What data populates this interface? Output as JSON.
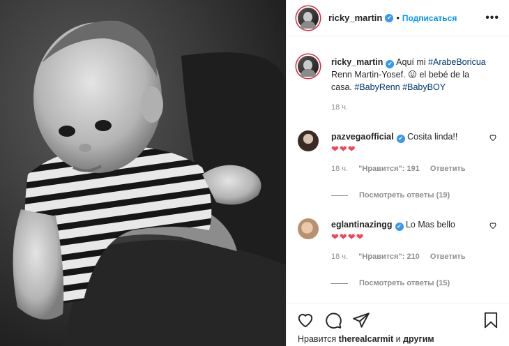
{
  "photo": {
    "alt": ""
  },
  "header": {
    "username": "ricky_martin",
    "separator": "•",
    "follow_label": "Подписаться",
    "more_label": "•••"
  },
  "caption": {
    "username": "ricky_martin",
    "text_1": "Aquí mi",
    "hashtag_1": "#ArabeBoricua",
    "text_2": "Renn Martin-Yosef. 😛 el bebé de la casa.",
    "hashtag_2": "#BabyRenn",
    "hashtag_3": "#BabyBOY",
    "time": "18 ч."
  },
  "comments": [
    {
      "username": "pazvegaofficial",
      "text": "Cosita linda!!",
      "hearts": "❤❤❤",
      "time": "18 ч.",
      "likes": "\"Нравится\": 191",
      "reply_label": "Ответить",
      "view_replies": "Посмотреть ответы (19)"
    },
    {
      "username": "eglantinazingg",
      "text": "Lo Mas bello",
      "hearts": "❤❤❤❤",
      "time": "18 ч.",
      "likes": "\"Нравится\": 210",
      "reply_label": "Ответить",
      "view_replies": "Посмотреть ответы (15)"
    }
  ],
  "likes_line": {
    "prefix": "Нравится",
    "user": "therealcarmit",
    "connector": "и",
    "others": "другим"
  },
  "colors": {
    "link": "#0095f6",
    "hashtag": "#00376b",
    "heart": "#ed4956",
    "verified": "#3897f0"
  }
}
